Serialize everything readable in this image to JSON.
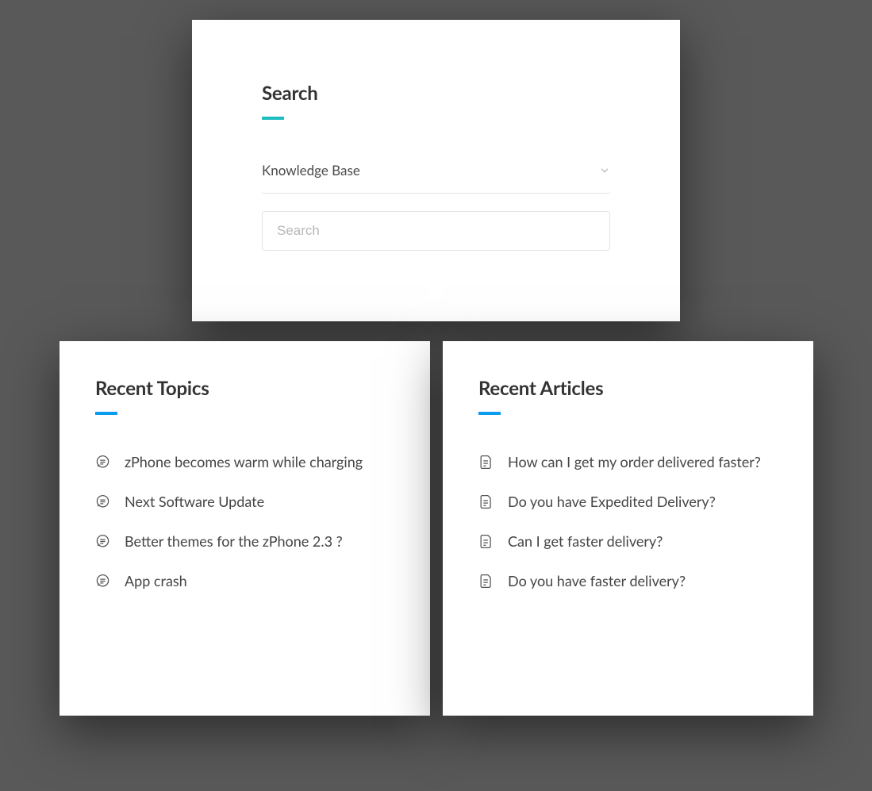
{
  "search": {
    "title": "Search",
    "dropdown_label": "Knowledge Base",
    "placeholder": "Search"
  },
  "topics": {
    "title": "Recent Topics",
    "items": [
      "zPhone becomes warm while charging",
      "Next Software Update",
      "Better themes for the zPhone 2.3 ?",
      "App crash"
    ]
  },
  "articles": {
    "title": "Recent Articles",
    "items": [
      "How can I get my order delivered faster?",
      "Do you have Expedited Delivery?",
      "Can I get faster delivery?",
      "Do you have faster delivery?"
    ]
  }
}
